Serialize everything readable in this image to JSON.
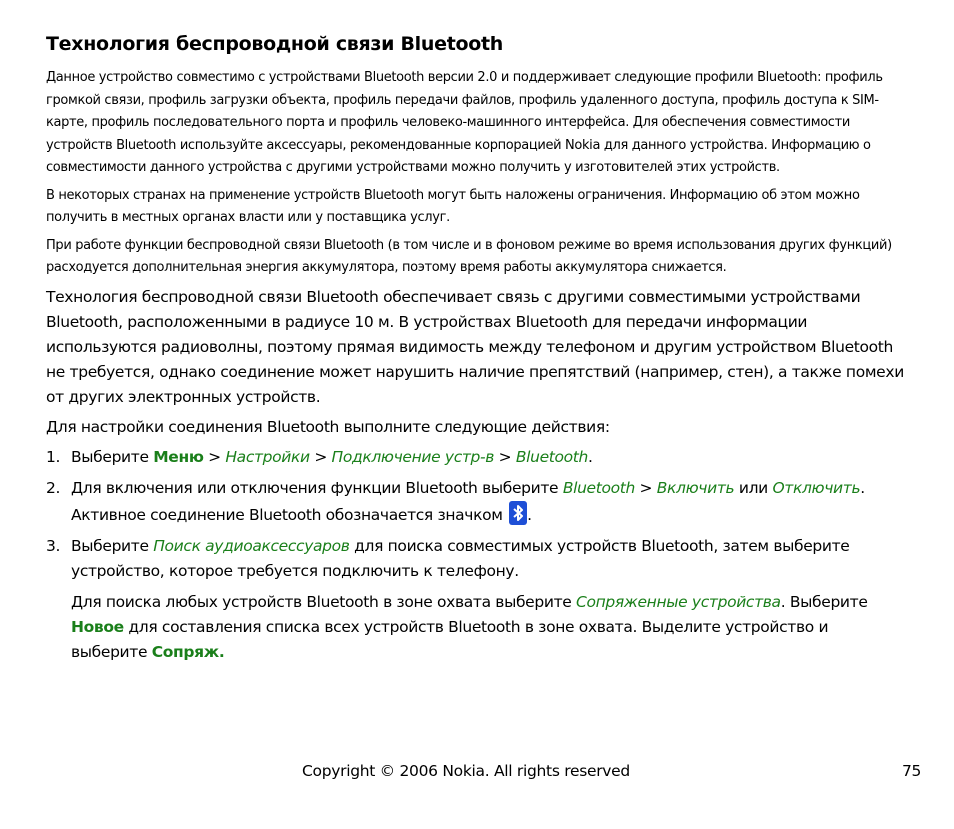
{
  "title": "Технология беспроводной связи Bluetooth",
  "paragraphs_small": [
    "Данное устройство совместимо с устройствами Bluetooth версии 2.0 и поддерживает следующие профили Bluetooth: профиль громкой связи, профиль загрузки объекта, профиль передачи файлов, профиль удаленного доступа, профиль доступа к SIM-карте, профиль последовательного порта и профиль человеко-машинного интерфейса. Для обеспечения совместимости устройств Bluetooth используйте аксессуары, рекомендованные корпорацией Nokia для данного устройства. Информацию о совместимости данного устройства с другими устройствами можно получить у изготовителей этих устройств.",
    "В некоторых странах на применение устройств Bluetooth могут быть наложены ограничения. Информацию об этом можно получить в местных органах власти или у поставщика услуг.",
    "При работе функции беспроводной связи Bluetooth (в том числе и в фоновом режиме во время использования других функций) расходуется дополнительная энергия аккумулятора, поэтому время работы аккумулятора снижается."
  ],
  "paragraphs_body": [
    "Технология беспроводной связи Bluetooth обеспечивает связь с другими совместимыми устройствами Bluetooth, расположенными в радиусе 10 м. В устройствах Bluetooth для передачи информации используются радиоволны, поэтому прямая видимость между телефоном и другим устройством Bluetooth не требуется, однако соединение может нарушить наличие препятствий (например, стен), а также помехи от других электронных устройств.",
    "Для настройки соединения Bluetooth выполните следующие действия:"
  ],
  "steps": [
    {
      "num": "1.",
      "t1": "Выберите ",
      "menu": "Меню",
      "sep1": " > ",
      "settings": "Настройки",
      "sep2": " > ",
      "connection": "Подключение устр-в",
      "sep3": " > ",
      "bluetooth": "Bluetooth",
      "end": "."
    },
    {
      "num": "2.",
      "t1": "Для включения или отключения функции Bluetooth выберите ",
      "bluetooth": "Bluetooth",
      "sep1": " > ",
      "on": "Включить",
      "or": " или ",
      "off": "Отключить",
      "t2": ". Активное соединение Bluetooth обозначается значком ",
      "icon": "bluetooth-icon",
      "end": "."
    },
    {
      "num": "3.",
      "t1": "Выберите ",
      "search": "Поиск аудиоаксессуаров",
      "t2": " для поиска совместимых устройств Bluetooth, затем выберите устройство, которое требуется подключить к телефону.",
      "sub_t1": "Для поиска любых устройств Bluetooth в зоне охвата выберите ",
      "paired": "Сопряженные устройства",
      "sub_t2": ". Выберите ",
      "new": "Новое",
      "sub_t3": " для составления списка всех устройств Bluetooth в зоне охвата. Выделите устройство и выберите ",
      "pair": "Сопряж."
    }
  ],
  "footer": {
    "copyright": "Copyright © 2006 Nokia. All rights reserved",
    "page_number": "75"
  },
  "colors": {
    "accent_green": "#1a7f1a",
    "bluetooth_icon_bg": "#1e4fd6"
  }
}
